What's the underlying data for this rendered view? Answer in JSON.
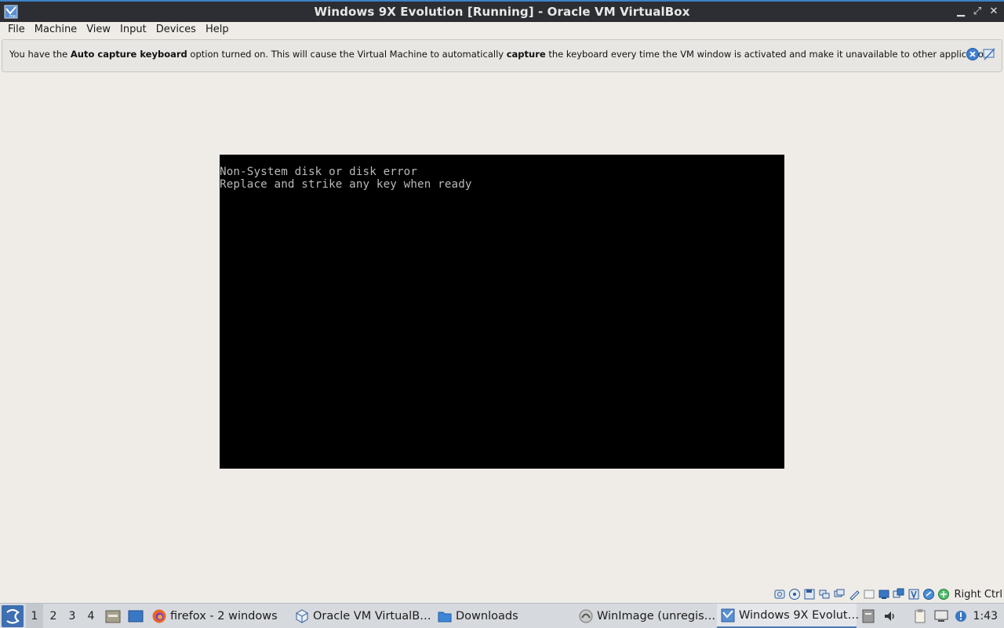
{
  "window": {
    "title": "Windows 9X Evolution [Running] - Oracle VM VirtualBox",
    "minimize_glyph": "▁",
    "maximize_glyph": "⤢",
    "close_glyph": "✕"
  },
  "menu": {
    "items": [
      "File",
      "Machine",
      "View",
      "Input",
      "Devices",
      "Help"
    ]
  },
  "notice": {
    "part1": "You have the ",
    "bold1": "Auto capture keyboard",
    "part2": " option turned on. This will cause the Virtual Machine to automatically ",
    "bold2": "capture",
    "part3": " the keyboard every time the VM window is activated and make it unavailable to other applications"
  },
  "vm_screen": {
    "lines": [
      "Non-System disk or disk error",
      "Replace and strike any key when ready"
    ]
  },
  "statusbar": {
    "host_key": "Right Ctrl",
    "icons": [
      "hard-disk-icon",
      "optical-drive-icon",
      "floppy-icon",
      "network-icon",
      "usb-icon",
      "shared-folders-icon",
      "display-icon",
      "video-capture-icon",
      "cpu-icon",
      "mouse-integration-icon",
      "keyboard-capture-icon"
    ]
  },
  "taskbar": {
    "workspaces": [
      "1",
      "2",
      "3",
      "4"
    ],
    "tasks": {
      "firefox": "firefox - 2 windows",
      "virtualbox_manager": "Oracle VM VirtualB…",
      "downloads": "Downloads",
      "winimage": "WinImage (unregis…",
      "vm_window": "Windows 9X Evolut…"
    },
    "clock": "1:43"
  },
  "colors": {
    "accent": "#4a7ab8",
    "titlebar_bg": "#2c2e33",
    "vm_text": "#b9b9b9"
  }
}
